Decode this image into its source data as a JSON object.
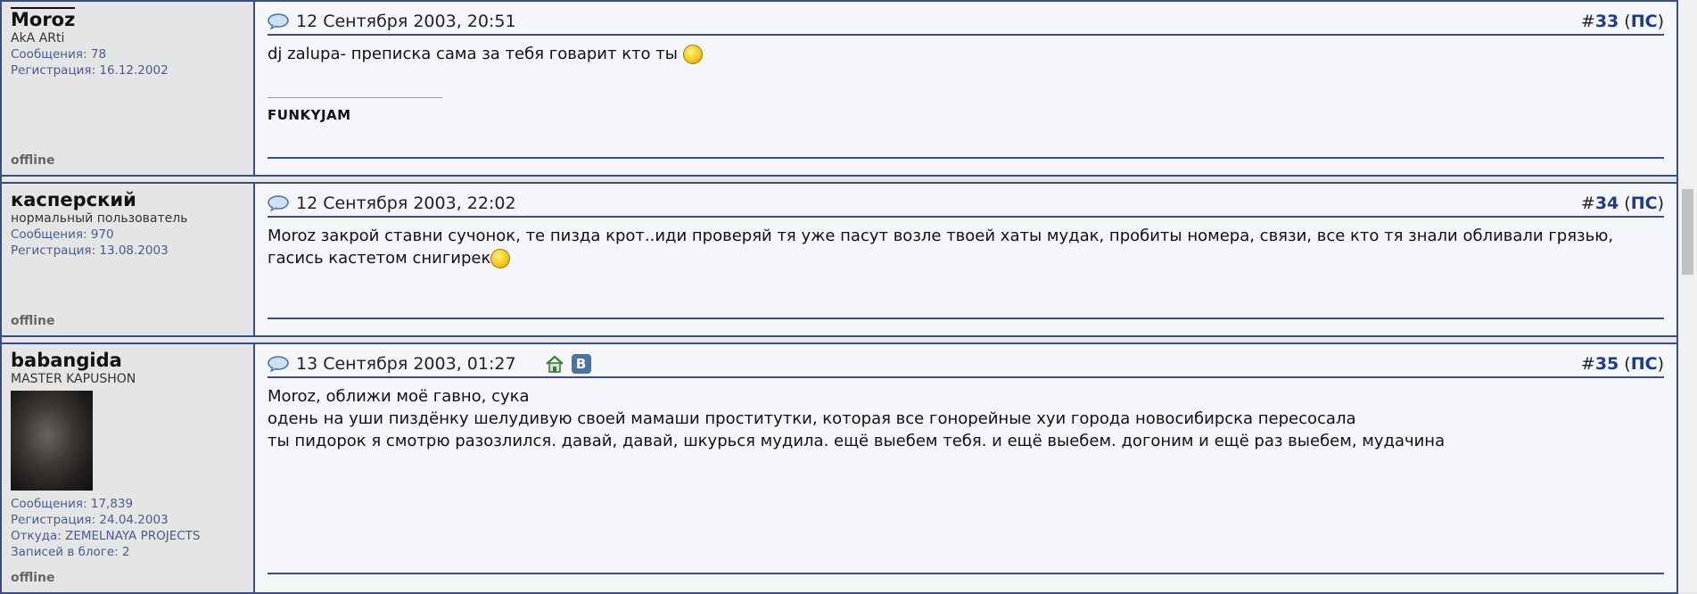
{
  "posts": [
    {
      "user": {
        "name": "Moroz",
        "title": "AkA ARti",
        "messages": "Сообщения: 78",
        "registered": "Регистрация: 16.12.2002",
        "status": "offline"
      },
      "date": "12 Сентября 2003, 20:51",
      "number_prefix": "#",
      "number": "33",
      "ps_open": " (",
      "ps": "ПС",
      "ps_close": ")",
      "text": "dj zalupa- преписка сама за тебя говарит кто ты",
      "signature": "FUNKYJAM"
    },
    {
      "user": {
        "name": "касперский",
        "title": "нормальный пользователь",
        "messages": "Сообщения: 970",
        "registered": "Регистрация: 13.08.2003",
        "status": "offline"
      },
      "date": "12 Сентября 2003, 22:02",
      "number_prefix": "#",
      "number": "34",
      "ps_open": " (",
      "ps": "ПС",
      "ps_close": ")",
      "text": "Moroz закрой ставни сучонок, те пизда крот..иди проверяй тя уже пасут возле твоей хаты мудак, пробиты номера, связи, все кто тя знали обливали грязью, гасись кастетом снигирек"
    },
    {
      "user": {
        "name": "babangida",
        "title": "MASTER KAPUSHON",
        "messages": "Сообщения: 17,839",
        "registered": "Регистрация: 24.04.2003",
        "from": "Откуда: ZEMELNAYA PROJECTS",
        "blog": "Записей в блоге: 2",
        "status": "offline"
      },
      "date": "13 Сентября 2003, 01:27",
      "number_prefix": "#",
      "number": "35",
      "ps_open": " (",
      "ps": "ПС",
      "ps_close": ")",
      "lines": [
        "Moroz, оближи моё гавно, сука",
        "одень на уши пиздёнку шелудивую своей мамаши проститутки, которая все гонорейные хуи города новосибирска пересосала",
        "ты пидорок я смотрю разозлился. давай, давай, шкурься мудила. ещё выебем тебя. и ещё выебем. догоним и ещё раз выебем, мудачина"
      ],
      "vk_label": "В"
    }
  ],
  "colors": {
    "border": "#3b4c86",
    "link": "#1e3a8a",
    "stat": "#4a5a8c"
  }
}
